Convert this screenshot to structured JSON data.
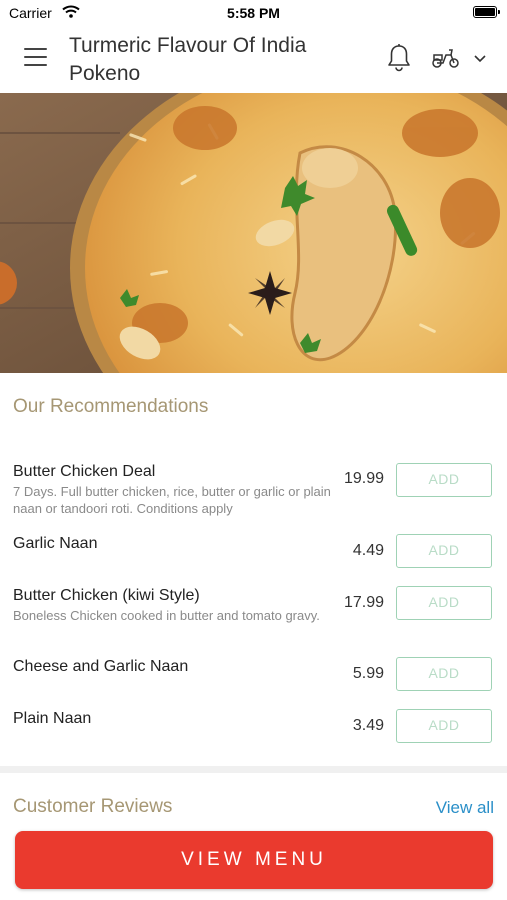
{
  "status_bar": {
    "carrier": "Carrier",
    "time": "5:58 PM"
  },
  "header": {
    "title": "Turmeric Flavour Of India Pokeno"
  },
  "recommendations": {
    "title": "Our Recommendations",
    "items": [
      {
        "name": "Butter Chicken Deal",
        "description": "7 Days. Full butter chicken, rice, butter or garlic or plain naan or tandoori roti. Conditions apply",
        "price": "19.99",
        "button": "ADD"
      },
      {
        "name": "Garlic Naan",
        "description": "",
        "price": "4.49",
        "button": "ADD"
      },
      {
        "name": "Butter Chicken (kiwi Style)",
        "description": "Boneless Chicken cooked in butter and tomato gravy.",
        "price": "17.99",
        "button": "ADD"
      },
      {
        "name": "Cheese and Garlic Naan",
        "description": "",
        "price": "5.99",
        "button": "ADD"
      },
      {
        "name": "Plain Naan",
        "description": "",
        "price": "3.49",
        "button": "ADD"
      }
    ]
  },
  "reviews": {
    "title": "Customer Reviews",
    "view_all": "View all"
  },
  "footer": {
    "view_menu": "VIEW MENU"
  },
  "colors": {
    "accent_red": "#ea3a2e",
    "section_title": "#a69774",
    "link_blue": "#2a8fc8",
    "add_border": "#9fd2b5"
  },
  "icons": [
    "wifi-icon",
    "battery-icon",
    "hamburger-menu-icon",
    "bell-icon",
    "scooter-icon",
    "chevron-down-icon"
  ]
}
